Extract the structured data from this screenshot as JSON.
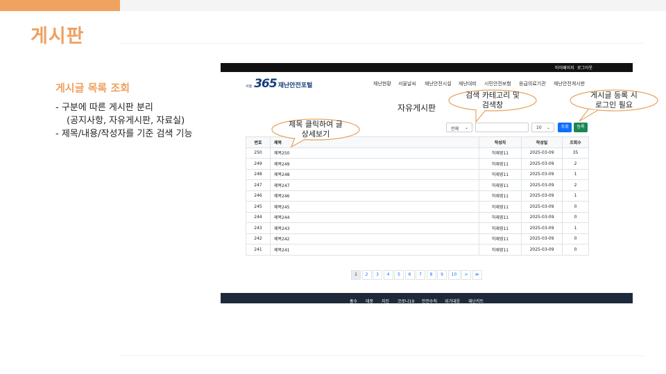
{
  "slide": {
    "title": "게시판",
    "section_title": "게시글 목록 조회",
    "bullets": [
      "- 구분에 따른 게시판 분리",
      "(공지사항, 자유게시판, 자료실)",
      "- 제목/내용/작성자를 기준 검색 기능"
    ]
  },
  "screenshot": {
    "top_links": [
      "마이페이지",
      "로그아웃"
    ],
    "logo": {
      "small": "서울",
      "number": "365",
      "text": "재난안전포털"
    },
    "nav": [
      "재난현황",
      "서울날씨",
      "재난안전시설",
      "재난대비",
      "시민안전보험",
      "응급의료기관",
      "재난안전게시판"
    ],
    "board_title": "자유게시판",
    "search": {
      "category": "전체",
      "keyword": "",
      "page_size": "10",
      "search_label": "조회",
      "register_label": "등록"
    },
    "table": {
      "headers": [
        "번호",
        "제목",
        "작성자",
        "작성일",
        "조회수"
      ],
      "rows": [
        [
          "250",
          "제목250",
          "허재영11",
          "2025-03-09",
          "35"
        ],
        [
          "249",
          "제목249",
          "허재영11",
          "2025-03-09",
          "2"
        ],
        [
          "248",
          "제목248",
          "허재영11",
          "2025-03-09",
          "1"
        ],
        [
          "247",
          "제목247",
          "허재영11",
          "2025-03-09",
          "2"
        ],
        [
          "246",
          "제목246",
          "허재영11",
          "2025-03-09",
          "1"
        ],
        [
          "245",
          "제목245",
          "허재영11",
          "2025-03-09",
          "0"
        ],
        [
          "244",
          "제목244",
          "허재영11",
          "2025-03-09",
          "0"
        ],
        [
          "243",
          "제목243",
          "허재영11",
          "2025-03-09",
          "1"
        ],
        [
          "242",
          "제목242",
          "허재영11",
          "2025-03-09",
          "0"
        ],
        [
          "241",
          "제목241",
          "허재영11",
          "2025-03-09",
          "0"
        ]
      ]
    },
    "pagination": [
      "1",
      "2",
      "3",
      "4",
      "5",
      "6",
      "7",
      "8",
      "9",
      "10",
      ">",
      "≫"
    ],
    "pagination_active": "1",
    "footer_links": [
      "홍수",
      "태풍",
      "지진",
      "코로나19",
      "안전수칙",
      "위기대응",
      "재난키트"
    ]
  },
  "callouts": {
    "search_category": [
      "검색 카테고리 및",
      "검색창"
    ],
    "register": [
      "게시글 등록 시",
      "로그인 필요"
    ],
    "title_click": [
      "제목 클릭하여 글",
      "상세보기"
    ]
  },
  "colors": {
    "accent": "#f0a060",
    "header_bar": "#111111",
    "footer": "#1e2a3a",
    "search_button": "#0d6efd",
    "register_button": "#198754",
    "callout_fill": "#ffffff",
    "callout_stroke": "#e8a35e"
  }
}
